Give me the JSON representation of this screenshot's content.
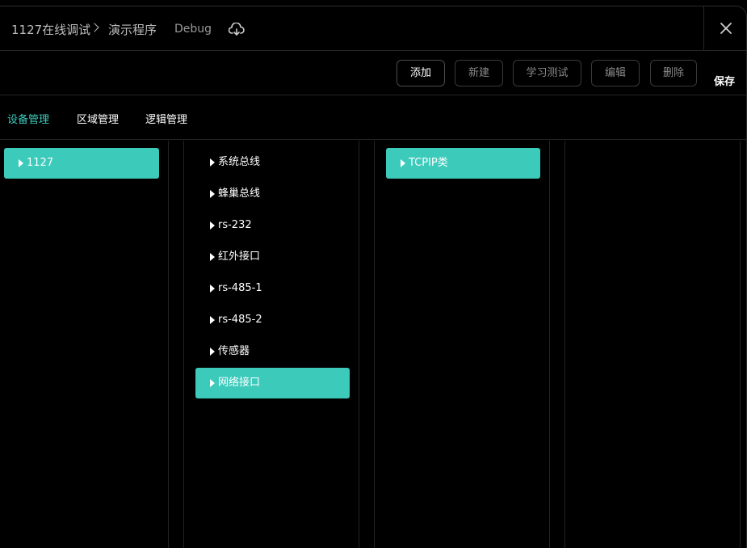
{
  "header": {
    "breadcrumb": [
      "1127在线调试",
      "演示程序"
    ],
    "mode": "Debug"
  },
  "toolbar": {
    "add": "添加",
    "new": "新建",
    "learn_test": "学习测试",
    "edit": "编辑",
    "delete": "删除",
    "save": "保存"
  },
  "tabs": [
    "设备管理",
    "区域管理",
    "逻辑管理"
  ],
  "columns": {
    "devices": [
      "1127"
    ],
    "buses": [
      "系统总线",
      "蜂巢总线",
      "rs-232",
      "红外接口",
      "rs-485-1",
      "rs-485-2",
      "传感器",
      "网络接口"
    ],
    "types": [
      "TCPIP类"
    ]
  },
  "colors": {
    "accent": "#3ccabb",
    "background": "#000000"
  },
  "icons": {
    "cloud": "cloud-sync-icon",
    "close": "close-icon",
    "expand": "triangle-right-icon"
  }
}
